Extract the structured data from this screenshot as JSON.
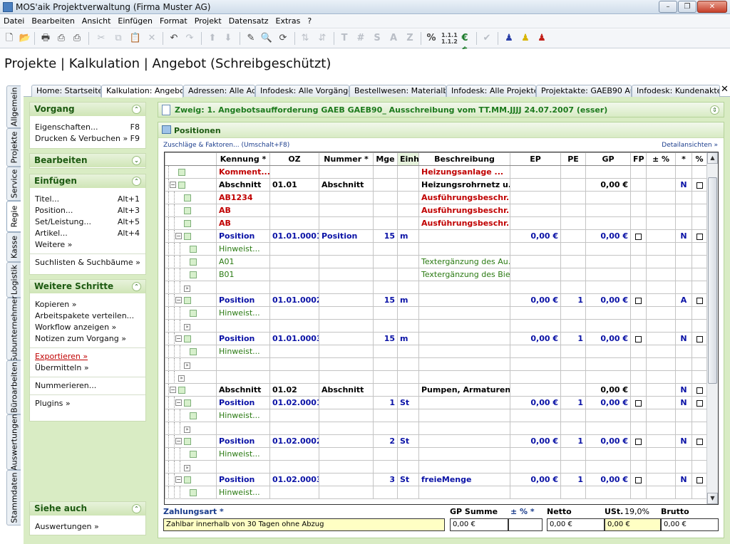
{
  "window": {
    "title": "MOS'aik Projektverwaltung (Firma Muster AG)"
  },
  "menu": [
    "Datei",
    "Bearbeiten",
    "Ansicht",
    "Einfügen",
    "Format",
    "Projekt",
    "Datensatz",
    "Extras",
    "?"
  ],
  "page_title": "Projekte | Kalkulation | Angebot (Schreibgeschützt)",
  "vertical_tabs": [
    "Allgemein",
    "Projekte",
    "Service",
    "Regie",
    "Kasse",
    "Logistik",
    "Subunternehmer",
    "Büroarbeiten",
    "Auswertungen",
    "Stammdaten"
  ],
  "tabs": [
    "Home: Startseite",
    "Kalkulation: Angebot",
    "Adressen: Alle Adr",
    "Infodesk: Alle Vorgänge",
    "Bestellwesen: Materialbe",
    "Infodesk: Alle Projekte",
    "Projektakte: GAEB90 Aus",
    "Infodesk: Kundenakte"
  ],
  "sidebar": {
    "vorgang": {
      "title": "Vorgang",
      "items": [
        {
          "label": "Eigenschaften...",
          "shortcut": "F8"
        },
        {
          "label": "Drucken & Verbuchen »",
          "shortcut": "F9"
        }
      ]
    },
    "bearbeiten": {
      "title": "Bearbeiten"
    },
    "einfuegen": {
      "title": "Einfügen",
      "items": [
        {
          "label": "Titel...",
          "shortcut": "Alt+1"
        },
        {
          "label": "Position...",
          "shortcut": "Alt+3"
        },
        {
          "label": "Set/Leistung...",
          "shortcut": "Alt+5"
        },
        {
          "label": "Artikel...",
          "shortcut": "Alt+4"
        },
        {
          "label": "Weitere »",
          "shortcut": ""
        }
      ],
      "extra": "Suchlisten & Suchbäume »"
    },
    "weitere": {
      "title": "Weitere Schritte",
      "items": [
        "Kopieren »",
        "Arbeitspakete verteilen...",
        "Workflow anzeigen »",
        "Notizen zum Vorgang »"
      ],
      "items2": [
        "Exportieren »",
        "Übermitteln »"
      ],
      "items3": [
        "Nummerieren..."
      ],
      "items4": [
        "Plugins »"
      ]
    },
    "siehe": {
      "title": "Siehe auch",
      "items": [
        "Auswertungen »"
      ]
    }
  },
  "branch": "Zweig: 1. Angebotsaufforderung GAEB GAEB90_ Ausschreibung vom TT.MM.JJJJ 24.07.2007 (esser)",
  "positions": {
    "title": "Positionen",
    "zuschlag_link": "Zuschläge & Faktoren... (Umschalt+F8)",
    "detail_link": "Detailansichten »",
    "columns": [
      "Kennung *",
      "OZ",
      "Nummer *",
      "Mge",
      "Einh",
      "Beschreibung",
      "EP",
      "PE",
      "GP",
      "FP",
      "± %",
      "*",
      "%"
    ],
    "rows": [
      {
        "indent": 1,
        "type": "leaf",
        "kennung": "Komment...",
        "k_style": "cred",
        "oz": "",
        "nummer": "",
        "mge": "",
        "einh": "",
        "besch": "Heizungsanlage ...",
        "b_style": "cred",
        "ep": "",
        "pe": "",
        "gp": "",
        "fp": false,
        "star": "",
        "pct": false
      },
      {
        "indent": 1,
        "type": "exp",
        "kennung": "Abschnitt",
        "k_style": "cbl",
        "oz": "01.01",
        "nummer": "Abschnitt",
        "mge": "",
        "einh": "",
        "besch": "Heizungsrohrnetz u...",
        "b_style": "cbl",
        "ep": "",
        "pe": "",
        "gp": "0,00 €",
        "fp": false,
        "star": "N",
        "pct": true
      },
      {
        "indent": 2,
        "type": "leaf",
        "kennung": "AB1234",
        "k_style": "cred",
        "oz": "",
        "nummer": "",
        "mge": "",
        "einh": "",
        "besch": "Ausführungsbeschr...",
        "b_style": "cred",
        "ep": "",
        "pe": "",
        "gp": "",
        "fp": false,
        "star": "",
        "pct": false
      },
      {
        "indent": 2,
        "type": "leaf",
        "kennung": "AB",
        "k_style": "cred",
        "oz": "",
        "nummer": "",
        "mge": "",
        "einh": "",
        "besch": "Ausführungsbeschr...",
        "b_style": "cred",
        "ep": "",
        "pe": "",
        "gp": "",
        "fp": false,
        "star": "",
        "pct": false
      },
      {
        "indent": 2,
        "type": "leaf",
        "kennung": "AB",
        "k_style": "cred",
        "oz": "",
        "nummer": "",
        "mge": "",
        "einh": "",
        "besch": "Ausführungsbeschr...",
        "b_style": "cred",
        "ep": "",
        "pe": "",
        "gp": "",
        "fp": false,
        "star": "",
        "pct": false
      },
      {
        "indent": 2,
        "type": "exp",
        "kennung": "Position",
        "k_style": "cblue",
        "oz": "01.01.0001",
        "nummer": "Position",
        "mge": "15",
        "einh": "m",
        "besch": "",
        "b_style": "cblue",
        "ep": "0,00 €",
        "pe": "",
        "gp": "0,00 €",
        "fp": true,
        "star": "N",
        "pct": true
      },
      {
        "indent": 3,
        "type": "leaf",
        "kennung": "Hinweist...",
        "k_style": "cgreen",
        "oz": "",
        "nummer": "",
        "mge": "",
        "einh": "",
        "besch": "",
        "b_style": "cgreen",
        "ep": "",
        "pe": "",
        "gp": "",
        "fp": false,
        "star": "",
        "pct": false
      },
      {
        "indent": 3,
        "type": "leaf",
        "kennung": "A01",
        "k_style": "cgreen",
        "oz": "",
        "nummer": "",
        "mge": "",
        "einh": "",
        "besch": "Textergänzung des Au...",
        "b_style": "cgreen",
        "ep": "",
        "pe": "",
        "gp": "",
        "fp": false,
        "star": "",
        "pct": false
      },
      {
        "indent": 3,
        "type": "leaf",
        "kennung": "B01",
        "k_style": "cgreen",
        "oz": "",
        "nummer": "",
        "mge": "",
        "einh": "",
        "besch": "Textergänzung des Bie...",
        "b_style": "cgreen",
        "ep": "",
        "pe": "",
        "gp": "",
        "fp": false,
        "star": "",
        "pct": false
      },
      {
        "indent": 3,
        "type": "more",
        "kennung": "",
        "k_style": "",
        "oz": "",
        "nummer": "",
        "mge": "",
        "einh": "",
        "besch": "",
        "b_style": "",
        "ep": "",
        "pe": "",
        "gp": "",
        "fp": false,
        "star": "",
        "pct": false
      },
      {
        "indent": 2,
        "type": "exp",
        "kennung": "Position",
        "k_style": "cblue",
        "oz": "01.01.0002",
        "nummer": "",
        "mge": "15",
        "einh": "m",
        "besch": "",
        "b_style": "cblue",
        "ep": "0,00 €",
        "pe": "1",
        "gp": "0,00 €",
        "fp": true,
        "star": "A",
        "pct": true
      },
      {
        "indent": 3,
        "type": "leaf",
        "kennung": "Hinweist...",
        "k_style": "cgreen",
        "oz": "",
        "nummer": "",
        "mge": "",
        "einh": "",
        "besch": "",
        "b_style": "cgreen",
        "ep": "",
        "pe": "",
        "gp": "",
        "fp": false,
        "star": "",
        "pct": false
      },
      {
        "indent": 3,
        "type": "more",
        "kennung": "",
        "k_style": "",
        "oz": "",
        "nummer": "",
        "mge": "",
        "einh": "",
        "besch": "",
        "b_style": "",
        "ep": "",
        "pe": "",
        "gp": "",
        "fp": false,
        "star": "",
        "pct": false
      },
      {
        "indent": 2,
        "type": "exp",
        "kennung": "Position",
        "k_style": "cblue",
        "oz": "01.01.0003",
        "nummer": "",
        "mge": "15",
        "einh": "m",
        "besch": "",
        "b_style": "cblue",
        "ep": "0,00 €",
        "pe": "1",
        "gp": "0,00 €",
        "fp": true,
        "star": "N",
        "pct": true
      },
      {
        "indent": 3,
        "type": "leaf",
        "kennung": "Hinweist...",
        "k_style": "cgreen",
        "oz": "",
        "nummer": "",
        "mge": "",
        "einh": "",
        "besch": "",
        "b_style": "cgreen",
        "ep": "",
        "pe": "",
        "gp": "",
        "fp": false,
        "star": "",
        "pct": false
      },
      {
        "indent": 3,
        "type": "more",
        "kennung": "",
        "k_style": "",
        "oz": "",
        "nummer": "",
        "mge": "",
        "einh": "",
        "besch": "",
        "b_style": "",
        "ep": "",
        "pe": "",
        "gp": "",
        "fp": false,
        "star": "",
        "pct": false
      },
      {
        "indent": 2,
        "type": "more",
        "kennung": "",
        "k_style": "",
        "oz": "",
        "nummer": "",
        "mge": "",
        "einh": "",
        "besch": "",
        "b_style": "",
        "ep": "",
        "pe": "",
        "gp": "",
        "fp": false,
        "star": "",
        "pct": false
      },
      {
        "indent": 1,
        "type": "exp",
        "kennung": "Abschnitt",
        "k_style": "cbl",
        "oz": "01.02",
        "nummer": "Abschnitt",
        "mge": "",
        "einh": "",
        "besch": "Pumpen, Armaturen",
        "b_style": "cbl",
        "ep": "",
        "pe": "",
        "gp": "0,00 €",
        "fp": false,
        "star": "N",
        "pct": true
      },
      {
        "indent": 2,
        "type": "exp",
        "kennung": "Position",
        "k_style": "cblue",
        "oz": "01.02.0001",
        "nummer": "",
        "mge": "1",
        "einh": "St",
        "besch": "",
        "b_style": "cblue",
        "ep": "0,00 €",
        "pe": "1",
        "gp": "0,00 €",
        "fp": true,
        "star": "N",
        "pct": true
      },
      {
        "indent": 3,
        "type": "leaf",
        "kennung": "Hinweist...",
        "k_style": "cgreen",
        "oz": "",
        "nummer": "",
        "mge": "",
        "einh": "",
        "besch": "",
        "b_style": "cgreen",
        "ep": "",
        "pe": "",
        "gp": "",
        "fp": false,
        "star": "",
        "pct": false
      },
      {
        "indent": 3,
        "type": "more",
        "kennung": "",
        "k_style": "",
        "oz": "",
        "nummer": "",
        "mge": "",
        "einh": "",
        "besch": "",
        "b_style": "",
        "ep": "",
        "pe": "",
        "gp": "",
        "fp": false,
        "star": "",
        "pct": false
      },
      {
        "indent": 2,
        "type": "exp",
        "kennung": "Position",
        "k_style": "cblue",
        "oz": "01.02.0002",
        "nummer": "",
        "mge": "2",
        "einh": "St",
        "besch": "",
        "b_style": "cblue",
        "ep": "0,00 €",
        "pe": "1",
        "gp": "0,00 €",
        "fp": true,
        "star": "N",
        "pct": true
      },
      {
        "indent": 3,
        "type": "leaf",
        "kennung": "Hinweist...",
        "k_style": "cgreen",
        "oz": "",
        "nummer": "",
        "mge": "",
        "einh": "",
        "besch": "",
        "b_style": "cgreen",
        "ep": "",
        "pe": "",
        "gp": "",
        "fp": false,
        "star": "",
        "pct": false
      },
      {
        "indent": 3,
        "type": "more",
        "kennung": "",
        "k_style": "",
        "oz": "",
        "nummer": "",
        "mge": "",
        "einh": "",
        "besch": "",
        "b_style": "",
        "ep": "",
        "pe": "",
        "gp": "",
        "fp": false,
        "star": "",
        "pct": false
      },
      {
        "indent": 2,
        "type": "exp",
        "kennung": "Position",
        "k_style": "cblue",
        "oz": "01.02.0003",
        "nummer": "",
        "mge": "3",
        "einh": "St",
        "besch": "freieMenge",
        "b_style": "cblue",
        "ep": "0,00 €",
        "pe": "1",
        "gp": "0,00 €",
        "fp": true,
        "star": "N",
        "pct": true
      },
      {
        "indent": 3,
        "type": "leaf",
        "kennung": "Hinweist...",
        "k_style": "cgreen",
        "oz": "",
        "nummer": "",
        "mge": "",
        "einh": "",
        "besch": "",
        "b_style": "cgreen",
        "ep": "",
        "pe": "",
        "gp": "",
        "fp": false,
        "star": "",
        "pct": false
      }
    ]
  },
  "footer": {
    "zahlungsart_label": "Zahlungsart *",
    "zahlungsart_value": "Zahlbar innerhalb von 30 Tagen ohne Abzug",
    "gp_summe_label": "GP Summe",
    "gp_summe_value": "0,00 €",
    "pm_label": "± % *",
    "pm_value": "",
    "netto_label": "Netto",
    "netto_value": "0,00 €",
    "ust_label": "USt.",
    "ust_rate": "19,0%",
    "ust_value": "0,00 €",
    "brutto_label": "Brutto",
    "brutto_value": "0,00 €"
  }
}
